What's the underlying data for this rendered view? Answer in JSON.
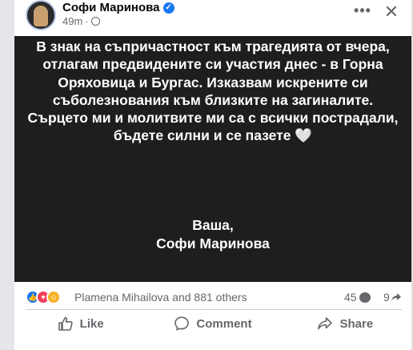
{
  "header": {
    "author": "Софи Маринова",
    "time": "49m",
    "more_label": "•••",
    "close_label": "✕"
  },
  "post": {
    "paragraph": "В знак на съпричастност към трагедията от вчера, отлагам предвидените си участия днес - в Горна Оряховица и Бургас. Изказвам искрените си съболезнования към близките на загиналите. Сърцето ми и молитвите ми са с всички пострадали, бъдете силни и се пазете",
    "heart_emoji": "🤍",
    "signoff_line1": "Ваша,",
    "signoff_line2": "Софи Маринова"
  },
  "reactions": {
    "summary": "Plamena Mihailova and 881 others",
    "comments_count": "45",
    "shares_count": "9"
  },
  "actions": {
    "like_label": "Like",
    "comment_label": "Comment",
    "share_label": "Share"
  },
  "colors": {
    "accent": "#1877f2",
    "post_background": "#1e1e1e",
    "secondary_text": "#65676b"
  }
}
